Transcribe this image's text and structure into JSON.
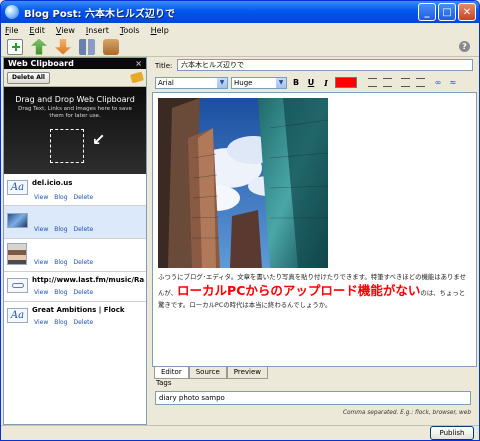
{
  "window": {
    "title": "Blog Post: 六本木ヒルズ辺りで",
    "controls": [
      "_",
      "□",
      "✕"
    ]
  },
  "menu": [
    {
      "label": "File"
    },
    {
      "label": "Edit"
    },
    {
      "label": "View"
    },
    {
      "label": "Insert"
    },
    {
      "label": "Tools"
    },
    {
      "label": "Help"
    }
  ],
  "toolbar": {
    "icons": [
      "new-post-icon",
      "upload-icon",
      "download-icon",
      "settings-icon",
      "open-icon"
    ],
    "help": "?"
  },
  "clipboard": {
    "header": "Web Clipboard",
    "close": "×",
    "delete_all": "Delete All",
    "drop_title": "Drag and Drop Web Clipboard",
    "drop_subtitle": "Drag Text, Links and Images here to save them for later use.",
    "items": [
      {
        "title": "del.icio.us",
        "thumb": "text-clip-icon",
        "actions": [
          "View",
          "Blog",
          "Delete"
        ]
      },
      {
        "title": "",
        "thumb": "image-clip-thumbnail",
        "actions": [
          "View",
          "Blog",
          "Delete"
        ],
        "selected": true
      },
      {
        "title": "",
        "thumb": "person-photo-thumbnail",
        "actions": [
          "View",
          "Blog",
          "Delete"
        ]
      },
      {
        "title": "http://www.last.fm/music/Ra...",
        "thumb": "link-clip-icon",
        "actions": [
          "View",
          "Blog",
          "Delete"
        ]
      },
      {
        "title": "Great Ambitions | Flock",
        "thumb": "text-clip-icon",
        "actions": [
          "View",
          "Blog",
          "Delete"
        ]
      }
    ]
  },
  "post": {
    "title_label": "Title:",
    "title_value": "六本木ヒルズ辺りで",
    "font_family": "Arial",
    "font_size": "Huge",
    "format_buttons": [
      "B",
      "U",
      "I"
    ],
    "text_color": "#ff0000",
    "body_line1": "ふつうにブログ･エディタ。文章を書いたり写真を貼り付けたりできます。特筆すべきほどの機能はありませんが、",
    "body_highlight": "ローカルPCからのアップロード機能がない",
    "body_line2": "のは、ちょっと驚きです。ローカルPCの時代は本当に終わるんでしょうか。",
    "tabs": [
      "Editor",
      "Source",
      "Preview"
    ],
    "active_tab": "Editor",
    "tags_label": "Tags",
    "tags_value": "diary photo sampo",
    "tags_hint": "Comma separated. E.g.: flock, browser, web"
  },
  "footer": {
    "publish": "Publish"
  }
}
